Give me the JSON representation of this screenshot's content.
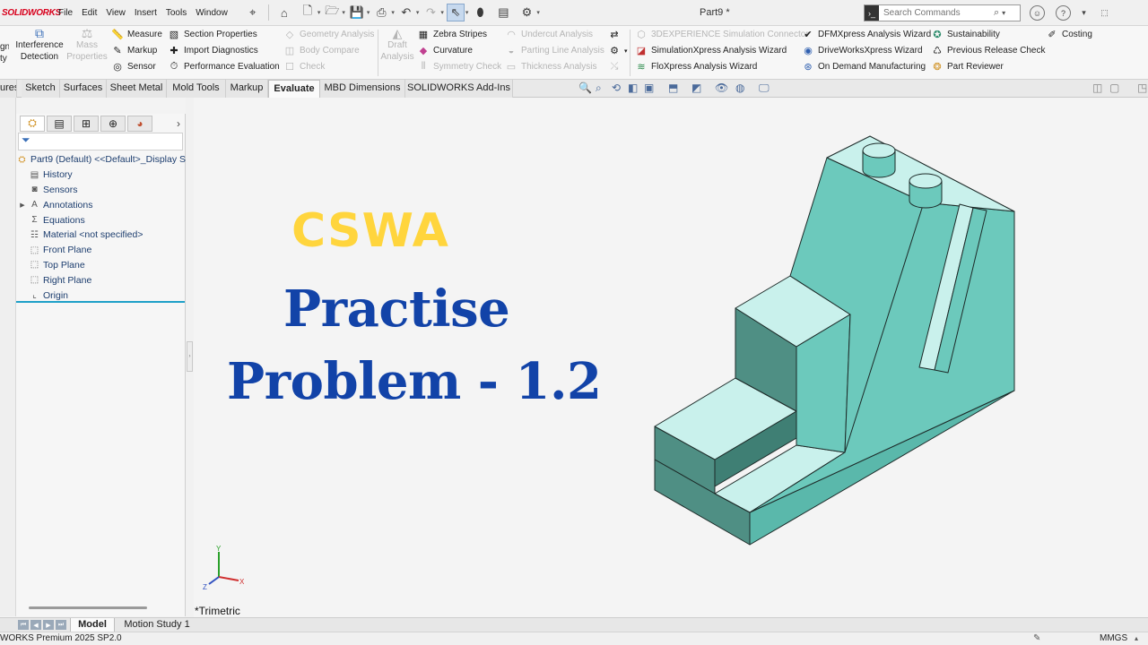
{
  "app": {
    "logo": "SOLIDWORKS",
    "document_title": "Part9 *",
    "menu": [
      "File",
      "Edit",
      "View",
      "Insert",
      "Tools",
      "Window"
    ]
  },
  "search": {
    "placeholder": "Search Commands"
  },
  "ribbon": {
    "left_cut": [
      "gn",
      "ty"
    ],
    "interference": [
      "Interference",
      "Detection"
    ],
    "mass": [
      "Mass",
      "Properties"
    ],
    "measure": "Measure",
    "markup": "Markup",
    "sensor": "Sensor",
    "section_properties": "Section Properties",
    "import_diagnostics": "Import Diagnostics",
    "performance_evaluation": "Performance Evaluation",
    "geometry_analysis": "Geometry Analysis",
    "body_compare": "Body Compare",
    "check": "Check",
    "draft": [
      "Draft",
      "Analysis"
    ],
    "zebra": "Zebra Stripes",
    "curvature": "Curvature",
    "symmetry": "Symmetry Check",
    "undercut": "Undercut Analysis",
    "parting": "Parting Line Analysis",
    "thickness": "Thickness Analysis",
    "threedx": "3DEXPERIENCE Simulation Connector",
    "simxpress": "SimulationXpress Analysis Wizard",
    "floxpress": "FloXpress Analysis Wizard",
    "dfmxpress": "DFMXpress Analysis Wizard",
    "driveworks": "DriveWorksXpress Wizard",
    "ondemand": "On Demand Manufacturing",
    "sustainability": "Sustainability",
    "prev_release": "Previous Release Check",
    "part_reviewer": "Part Reviewer",
    "costing": "Costing"
  },
  "tabs": [
    "ures",
    "Sketch",
    "Surfaces",
    "Sheet Metal",
    "Mold Tools",
    "Markup",
    "Evaluate",
    "MBD Dimensions",
    "SOLIDWORKS Add-Ins"
  ],
  "active_tab": "Evaluate",
  "tree": {
    "root": "Part9 (Default) <<Default>_Display S",
    "items": [
      "History",
      "Sensors",
      "Annotations",
      "Equations",
      "Material <not specified>",
      "Front Plane",
      "Top Plane",
      "Right Plane",
      "Origin"
    ]
  },
  "overlay": {
    "line1": "CSWA",
    "line2": "Practise",
    "line3": "Problem - 1.2"
  },
  "view": {
    "orientation": "*Trimetric",
    "axes": [
      "Y",
      "X",
      "Z"
    ]
  },
  "bottom_tabs": [
    "Model",
    "Motion Study 1"
  ],
  "status": {
    "product": "WORKS Premium 2025 SP2.0",
    "units": "MMGS"
  },
  "colors": {
    "model_face": "#6cc9bc",
    "model_top": "#c9f1ec",
    "title_yellow": "#ffd53d",
    "title_blue": "#1243a8"
  }
}
